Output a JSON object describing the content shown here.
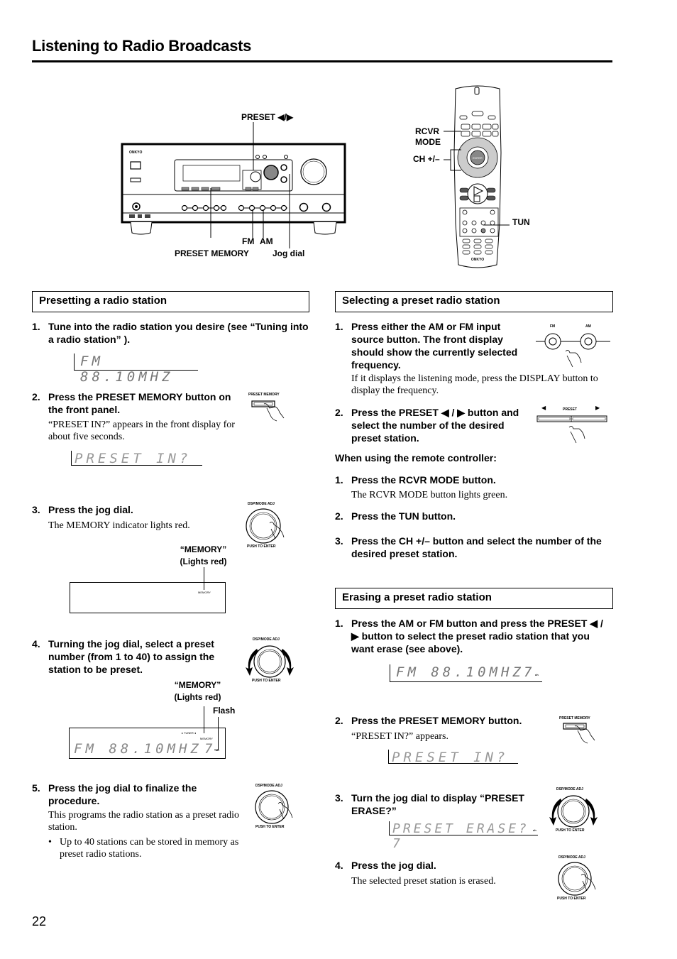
{
  "page": {
    "title": "Listening to Radio Broadcasts",
    "page_number": "22"
  },
  "figures": {
    "receiver": {
      "labels": {
        "preset": "PRESET ◀/▶",
        "fm": "FM",
        "am": "AM",
        "preset_memory": "PRESET MEMORY",
        "jog_dial": "Jog dial"
      },
      "brand": "ONKYO"
    },
    "remote": {
      "labels": {
        "rcvr_mode_line1": "RCVR",
        "rcvr_mode_line2": "MODE",
        "ch": "CH +/–",
        "tun": "TUN"
      },
      "brand": "ONKYO",
      "enter": "ENTER"
    }
  },
  "presetting": {
    "heading": "Presetting a radio station",
    "steps": [
      {
        "num": "1.",
        "text": "Tune into the radio station you desire (see “Tuning into a radio station” ).",
        "display": "FM  88.10MHZ"
      },
      {
        "num": "2.",
        "text": "Press the PRESET MEMORY button on the front panel.",
        "body": "“PRESET IN?” appears in the front display for about five seconds.",
        "display": "PRESET IN?",
        "button_label": "PRESET MEMORY"
      },
      {
        "num": "3.",
        "text": "Press the jog dial.",
        "body": "The MEMORY indicator lights red.",
        "callout_line1": "“MEMORY”",
        "callout_line2": "(Lights red)",
        "indicator": "MEMORY",
        "dial_top": "DSP/MODE ADJ",
        "dial_bottom": "PUSH TO ENTER"
      },
      {
        "num": "4.",
        "text": "Turning the jog dial, select a preset number (from 1 to 40) to assign the station to be preset.",
        "callout_line1": "“MEMORY”",
        "callout_line2": "(Lights red)",
        "flash": "Flash",
        "display": "FM  88.10MHZ",
        "preset_digit": "7",
        "tuner_indicator": "▸ TUNER ◂",
        "indicator": "MEMORY",
        "ch": "ch",
        "dial_top": "DSP/MODE ADJ",
        "dial_bottom": "PUSH TO ENTER"
      },
      {
        "num": "5.",
        "text": "Press the jog dial to finalize the procedure.",
        "body": "This programs the radio station as a preset radio station.",
        "bullet": "Up to 40 stations can be stored in memory as preset radio stations.",
        "dial_top": "DSP/MODE ADJ",
        "dial_bottom": "PUSH TO ENTER"
      }
    ]
  },
  "selecting": {
    "heading": "Selecting a preset radio station",
    "steps": [
      {
        "num": "1.",
        "text": "Press either the AM or FM input source button. The front display should show the currently selected frequency.",
        "body": "If it displays the listening mode, press the DISPLAY button to display the frequency.",
        "fm": "FM",
        "am": "AM"
      },
      {
        "num": "2.",
        "text": "Press the PRESET ◀ / ▶ button and select the number of the desired preset station.",
        "preset": "PRESET"
      }
    ],
    "remote_heading": "When using the remote controller:",
    "remote_steps": [
      {
        "num": "1.",
        "text": "Press the RCVR MODE button.",
        "body": "The RCVR MODE button lights green."
      },
      {
        "num": "2.",
        "text": "Press the TUN button."
      },
      {
        "num": "3.",
        "text": "Press the CH +/– button and select the number of the desired preset station."
      }
    ]
  },
  "erasing": {
    "heading": "Erasing a preset radio station",
    "steps": [
      {
        "num": "1.",
        "text": "Press the AM or FM button and press the PRESET ◀ / ▶ button to select the preset radio station that you want erase (see above).",
        "display": "FM  88.10MHZ",
        "preset_digit": "7",
        "ch": "ch"
      },
      {
        "num": "2.",
        "text": "Press the PRESET MEMORY button.",
        "body": "“PRESET IN?” appears.",
        "display": "PRESET IN?",
        "button_label": "PRESET MEMORY"
      },
      {
        "num": "3.",
        "text": "Turn the jog dial to display “PRESET ERASE?”",
        "display": "PRESET ERASE? 7",
        "ch": "ch",
        "dial_top": "DSP/MODE ADJ",
        "dial_bottom": "PUSH TO ENTER"
      },
      {
        "num": "4.",
        "text": "Press the jog dial.",
        "body": "The selected preset station is erased.",
        "dial_top": "DSP/MODE ADJ",
        "dial_bottom": "PUSH TO ENTER"
      }
    ]
  }
}
